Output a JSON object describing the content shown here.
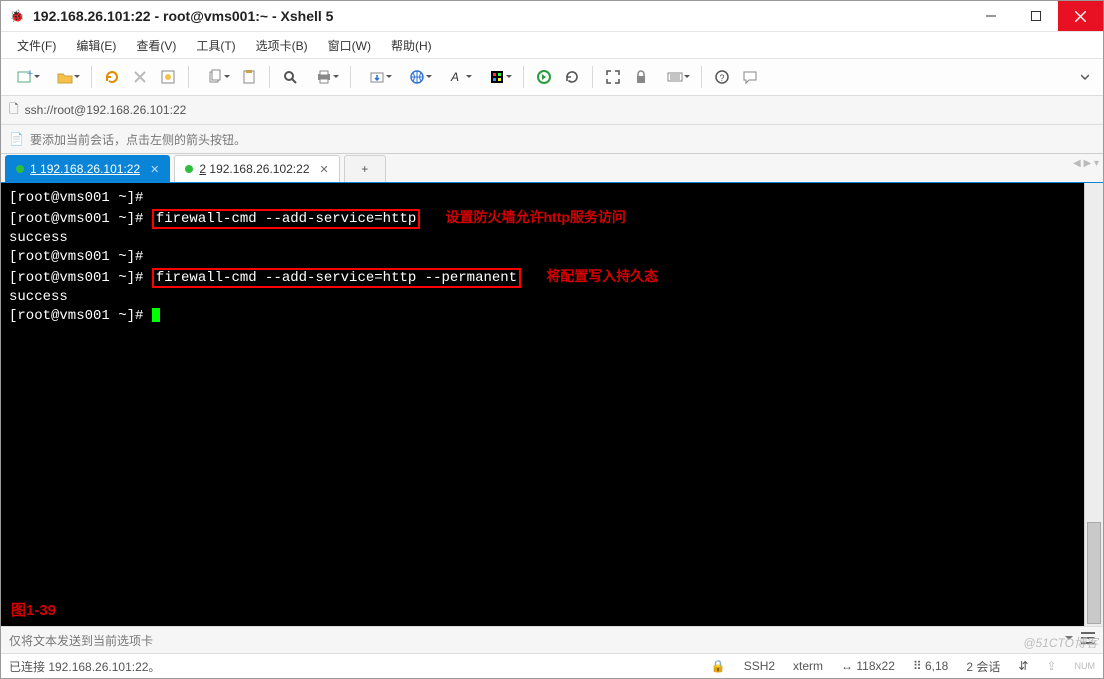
{
  "window": {
    "title": "192.168.26.101:22 - root@vms001:~ - Xshell 5"
  },
  "menu": {
    "file": "文件(F)",
    "edit": "编辑(E)",
    "view": "查看(V)",
    "tools": "工具(T)",
    "tabs": "选项卡(B)",
    "window": "窗口(W)",
    "help": "帮助(H)"
  },
  "icons": {
    "app": "🐞",
    "lock": "🔒",
    "bookmark": "🔖",
    "arrow": "➤",
    "ssh": "🔒",
    "cap": "⇪",
    "num": "NUM"
  },
  "address": "ssh://root@192.168.26.101:22",
  "hint": "要添加当前会话，点击左侧的箭头按钮。",
  "tabs": [
    {
      "index": "1",
      "label": "192.168.26.101:22",
      "active": true
    },
    {
      "index": "2",
      "label": "192.168.26.102:22",
      "active": false
    }
  ],
  "terminal": {
    "prompt": "[root@vms001 ~]#",
    "cmd1": "firewall-cmd --add-service=http",
    "annot1": "设置防火墙允许http服务访问",
    "success": "success",
    "cmd2": "firewall-cmd --add-service=http --permanent",
    "annot2": "将配置写入持久态",
    "figure": "图1-39"
  },
  "bottom": {
    "send_hint": "仅将文本发送到当前选项卡"
  },
  "status": {
    "connected": "已连接 192.168.26.101:22。",
    "proto": "SSH2",
    "term": "xterm",
    "size": "118x22",
    "pos": "6,18",
    "sessions": "2 会话",
    "arrows": "⇵"
  },
  "watermark": "@51CTO博客"
}
